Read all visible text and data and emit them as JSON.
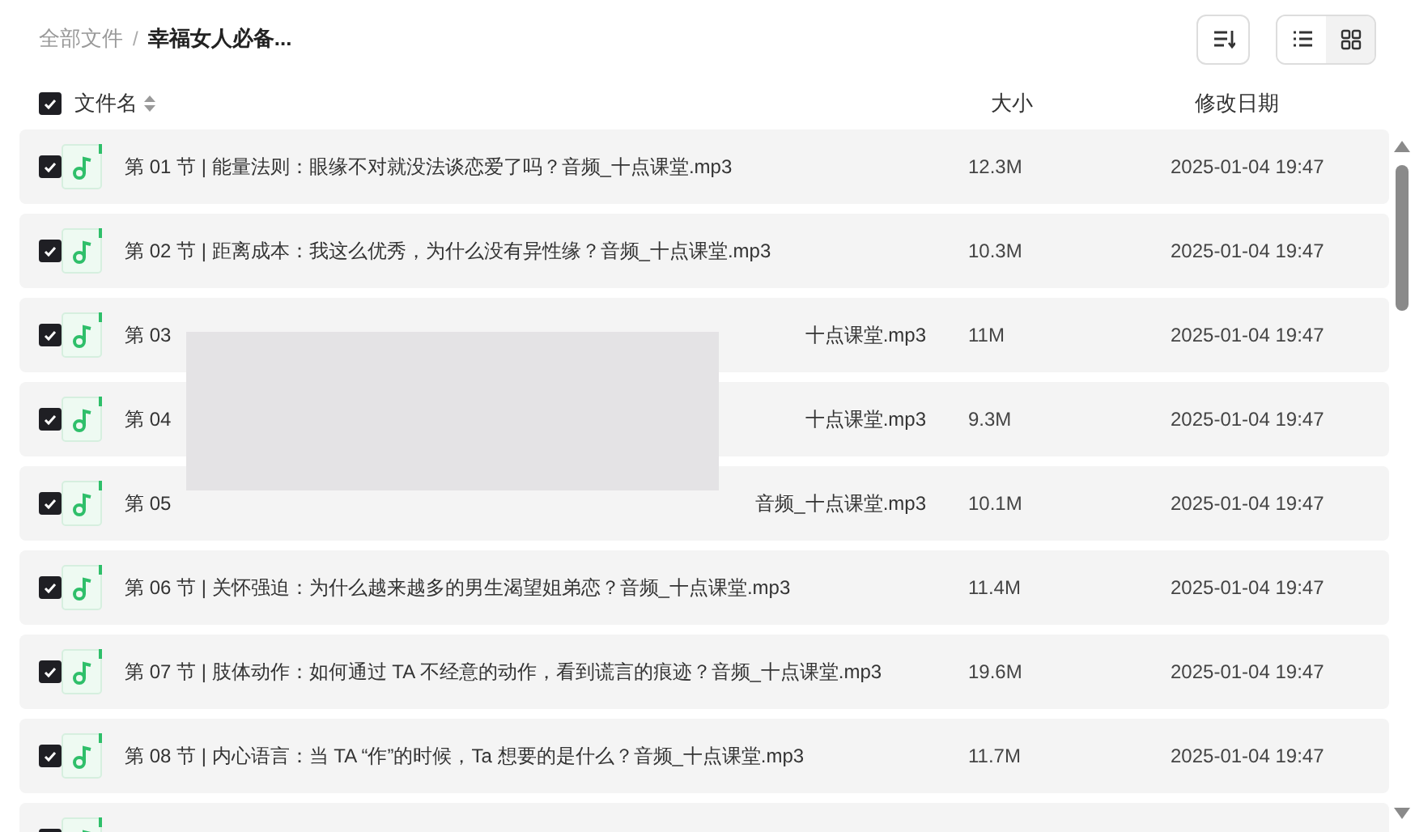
{
  "breadcrumb": [
    {
      "label": "全部文件",
      "current": false
    },
    {
      "label": "幸福女人必备...",
      "current": true
    }
  ],
  "breadcrumb_separator": "/",
  "toolbar": {
    "views": [
      {
        "kind": "list",
        "selected": true
      },
      {
        "kind": "grid",
        "selected": false
      }
    ]
  },
  "table": {
    "select_all": {
      "checked": true
    },
    "columns": [
      {
        "label": "文件名",
        "sortable": true
      },
      {
        "label": "大小",
        "sortable": false
      },
      {
        "label": "修改日期",
        "sortable": false
      }
    ],
    "rows": [
      {
        "checked": true,
        "name": "第 01 节 | 能量法则：眼缘不对就没法谈恋爱了吗？音频_十点课堂.mp3",
        "size": "12.3M",
        "date": "2025-01-04 19:47"
      },
      {
        "checked": true,
        "name": "第 02 节 | 距离成本：我这么优秀，为什么没有异性缘？音频_十点课堂.mp3",
        "size": "10.3M",
        "date": "2025-01-04 19:47"
      },
      {
        "checked": true,
        "name_start": "第 03",
        "name_end": "十点课堂.mp3",
        "size": "11M",
        "date": "2025-01-04 19:47"
      },
      {
        "checked": true,
        "name_start": "第 04",
        "name_end": "十点课堂.mp3",
        "size": "9.3M",
        "date": "2025-01-04 19:47"
      },
      {
        "checked": true,
        "name_start": "第 05",
        "name_end": "音频_十点课堂.mp3",
        "size": "10.1M",
        "date": "2025-01-04 19:47"
      },
      {
        "checked": true,
        "name": "第 06 节 | 关怀强迫：为什么越来越多的男生渴望姐弟恋？音频_十点课堂.mp3",
        "size": "11.4M",
        "date": "2025-01-04 19:47"
      },
      {
        "checked": true,
        "name": "第 07 节 | 肢体动作：如何通过 TA 不经意的动作，看到谎言的痕迹？音频_十点课堂.mp3",
        "size": "19.6M",
        "date": "2025-01-04 19:47"
      },
      {
        "checked": true,
        "name": "第 08 节 | 内心语言：当 TA “作”的时候，Ta 想要的是什么？音频_十点课堂.mp3",
        "size": "11.7M",
        "date": "2025-01-04 19:47"
      },
      {
        "checked": true
      }
    ]
  }
}
